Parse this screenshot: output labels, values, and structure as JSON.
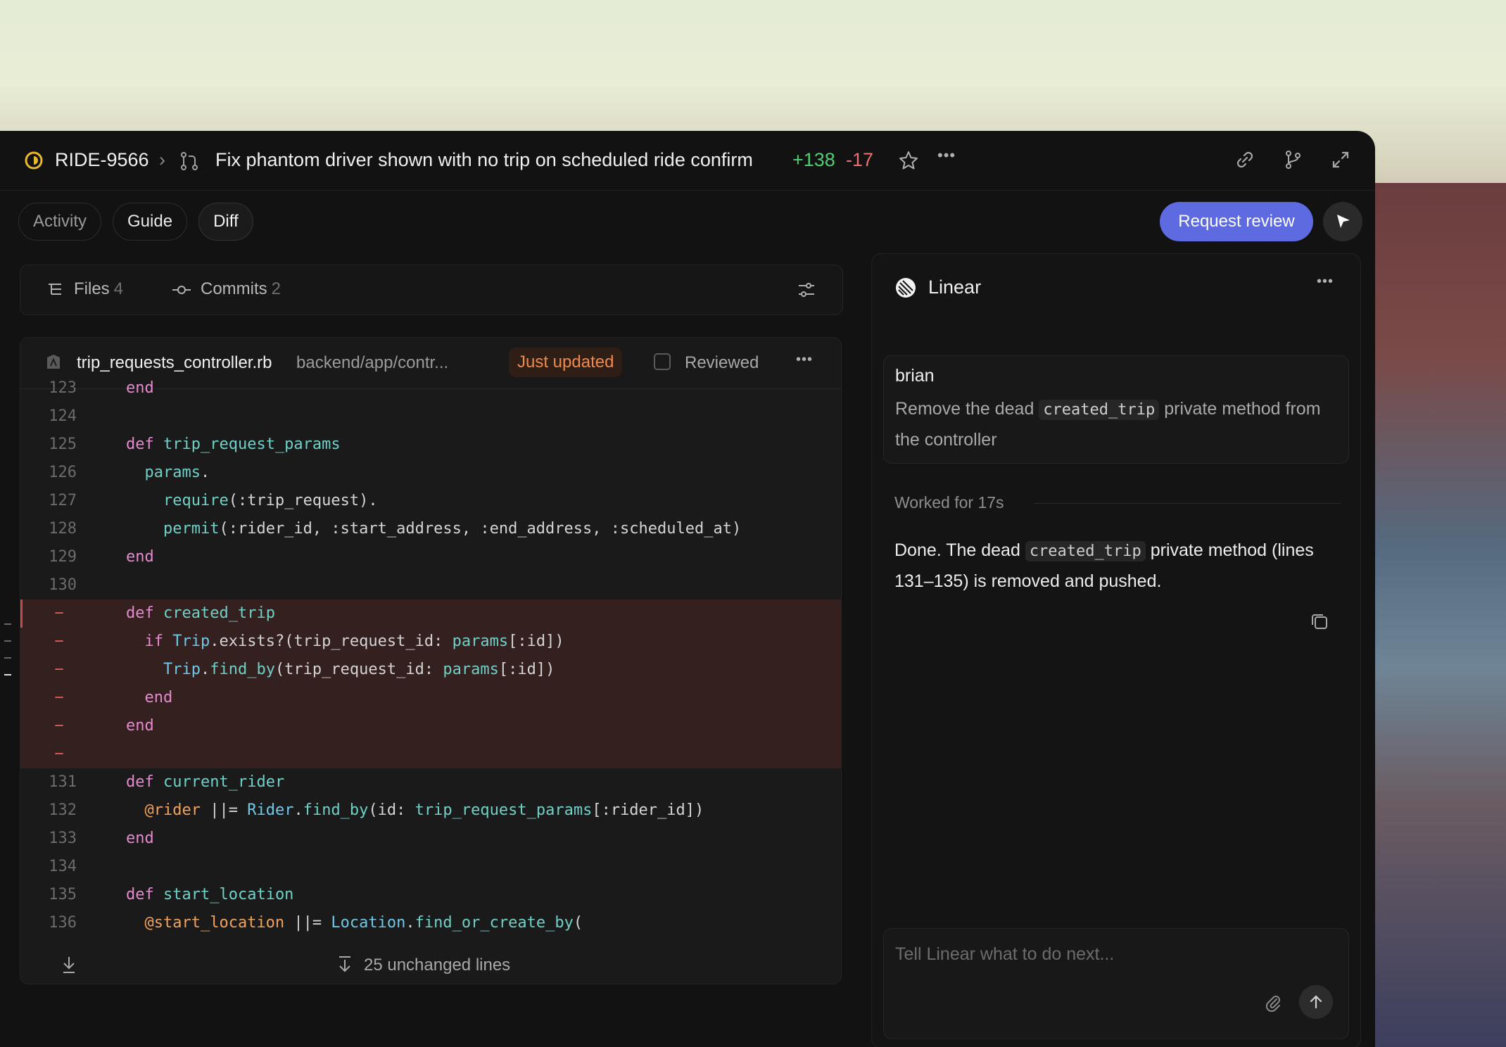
{
  "window": {
    "issue_key": "RIDE-9566",
    "breadcrumb_sep": "›",
    "pr_title": "Fix phantom driver shown with no trip on scheduled ride confirm",
    "additions": "+138",
    "deletions": "-17",
    "more": "•••"
  },
  "tabs": [
    {
      "label": "Activity"
    },
    {
      "label": "Guide"
    },
    {
      "label": "Diff"
    }
  ],
  "actions": {
    "request_review": "Request review"
  },
  "files_bar": {
    "files_label": "Files",
    "files_count": "4",
    "commits_label": "Commits",
    "commits_count": "2"
  },
  "diff": {
    "file_name": "trip_requests_controller.rb",
    "file_path": "backend/app/contr...",
    "badge": "Just updated",
    "reviewed_label": "Reviewed",
    "more": "•••",
    "lines": [
      {
        "n": "123",
        "t": "end"
      },
      {
        "n": "124",
        "t": ""
      },
      {
        "n": "125",
        "t": "def trip_request_params"
      },
      {
        "n": "126",
        "t": "  params."
      },
      {
        "n": "127",
        "t": "    require(:trip_request)."
      },
      {
        "n": "128",
        "t": "    permit(:rider_id, :start_address, :end_address, :scheduled_at)"
      },
      {
        "n": "129",
        "t": "end"
      },
      {
        "n": "130",
        "t": ""
      },
      {
        "n": "−",
        "t": "def created_trip"
      },
      {
        "n": "−",
        "t": "  if Trip.exists?(trip_request_id: params[:id])"
      },
      {
        "n": "−",
        "t": "    Trip.find_by(trip_request_id: params[:id])"
      },
      {
        "n": "−",
        "t": "  end"
      },
      {
        "n": "−",
        "t": "end"
      },
      {
        "n": "−",
        "t": ""
      },
      {
        "n": "131",
        "t": "def current_rider"
      },
      {
        "n": "132",
        "t": "  @rider ||= Rider.find_by(id: trip_request_params[:rider_id])"
      },
      {
        "n": "133",
        "t": "end"
      },
      {
        "n": "134",
        "t": ""
      },
      {
        "n": "135",
        "t": "def start_location"
      },
      {
        "n": "136",
        "t": "  @start_location ||= Location.find_or_create_by("
      }
    ],
    "unchanged": "25 unchanged lines"
  },
  "side_panel": {
    "title": "Linear",
    "more": "•••",
    "user": "brian",
    "user_msg_1": "Remove the dead",
    "user_msg_code": "created_trip",
    "user_msg_2": "private method from the controller",
    "worked": "Worked for 17s",
    "reply_1": "Done. The dead",
    "reply_code": "created_trip",
    "reply_2": "private method (lines 131–135) is removed and pushed.",
    "composer_placeholder": "Tell Linear what to do next..."
  },
  "colors": {
    "accent": "#5d6ae0",
    "additions": "#4fcf73",
    "deletions": "#f26d6d",
    "badge": "#f08a4a",
    "status": "#e8b92a"
  }
}
